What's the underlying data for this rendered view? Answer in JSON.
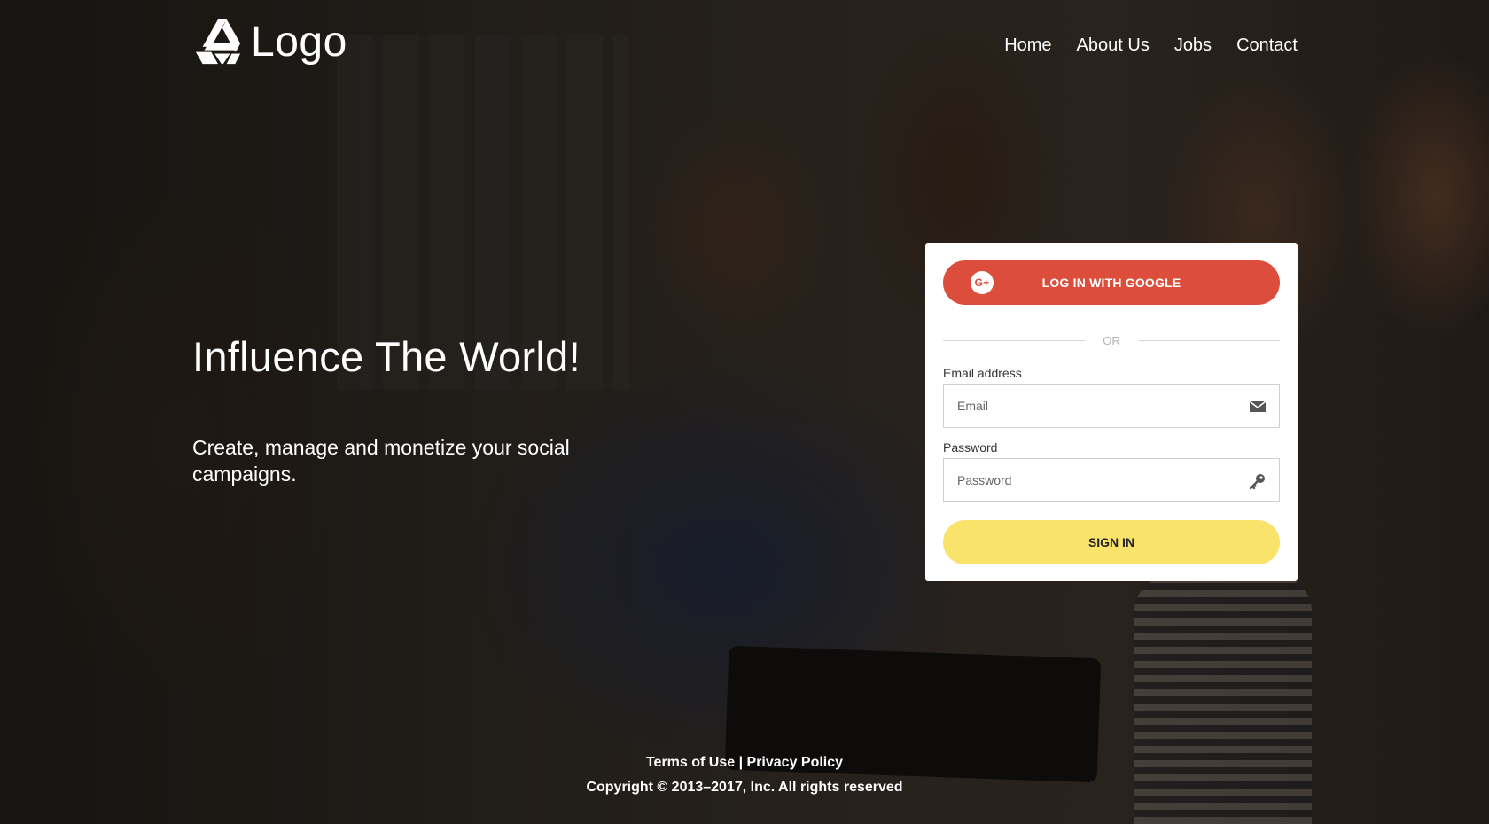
{
  "header": {
    "logo_text": "Logo",
    "nav": [
      {
        "label": "Home"
      },
      {
        "label": "About Us"
      },
      {
        "label": "Jobs"
      },
      {
        "label": "Contact"
      }
    ]
  },
  "hero": {
    "title": "Influence The World!",
    "subtitle": "Create, manage and monetize your social campaigns."
  },
  "login": {
    "google_button": "LOG IN WITH GOOGLE",
    "google_icon_glyph": "G+",
    "or_text": "OR",
    "email_label": "Email address",
    "email_placeholder": "Email",
    "password_label": "Password",
    "password_placeholder": "Password",
    "signin_button": "SIGN IN"
  },
  "footer": {
    "terms": "Terms of Use",
    "separator": "|",
    "privacy": "Privacy Policy",
    "copyright": "Copyright © 2013–2017, Inc. All rights reserved"
  },
  "colors": {
    "google_red": "#dc4e3b",
    "signin_yellow": "#fae36a"
  },
  "icons": {
    "logo": "triangle-knot-logo-icon",
    "google": "google-plus-icon",
    "email": "envelope-icon",
    "password": "key-icon"
  }
}
